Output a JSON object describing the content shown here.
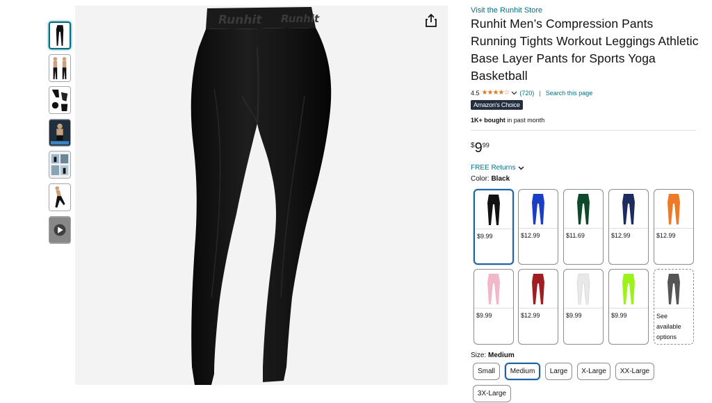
{
  "store_link": "Visit the Runhit Store",
  "title": "Runhit Men’s Compression Pants Running Tights Workout Leggings Athletic Base Layer Pants for Sports Yoga Basketball",
  "brand_on_waistband": "Runhit",
  "rating": {
    "value": "4.5",
    "stars": "★★★★☆",
    "count": "(720)",
    "search_link": "Search this page",
    "separator": "|"
  },
  "badge": "Amazon's Choice",
  "bought": {
    "bold": "1K+ bought",
    "rest": " in past month"
  },
  "price": {
    "symbol": "$",
    "whole": "9",
    "fraction": "99"
  },
  "returns": "FREE Returns",
  "color": {
    "label": "Color: ",
    "selected": "Black"
  },
  "swatches": [
    {
      "price": "$9.99",
      "color": "#111111"
    },
    {
      "price": "$12.99",
      "color": "#1a3fc4"
    },
    {
      "price": "$11.69",
      "color": "#0d4a2a"
    },
    {
      "price": "$12.99",
      "color": "#1c2c5e"
    },
    {
      "price": "$12.99",
      "color": "#ee7a27"
    },
    {
      "price": "$9.99",
      "color": "#f2b8c8"
    },
    {
      "price": "$12.99",
      "color": "#a01d22"
    },
    {
      "price": "$9.99",
      "color": "#e8e8e8"
    },
    {
      "price": "$9.99",
      "color": "#9ef21b"
    },
    {
      "see": [
        "See",
        "available",
        "options"
      ],
      "color": "#555555"
    }
  ],
  "size": {
    "label": "Size: ",
    "selected": "Medium",
    "options": [
      "Small",
      "Medium",
      "Large",
      "X-Large",
      "XX-Large",
      "3X-Large"
    ]
  },
  "colors": {
    "link": "#007185",
    "selected_border": "#2162a1",
    "star": "#de7921",
    "badge_bg": "#232f3e"
  },
  "icons": {
    "share": "share-icon",
    "chevron": "chevron-down-icon",
    "play": "play-icon"
  }
}
